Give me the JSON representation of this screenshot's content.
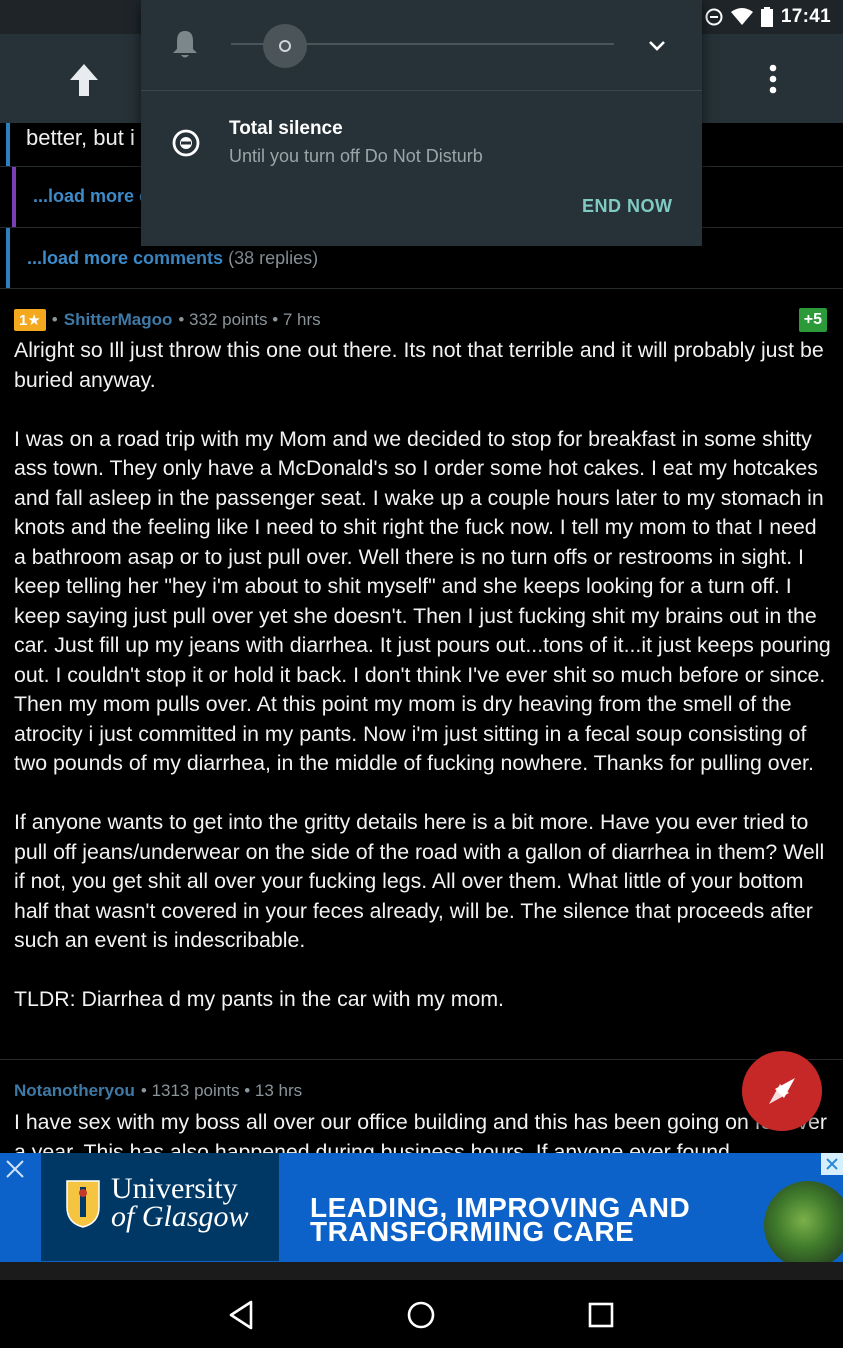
{
  "status_bar": {
    "time": "17:41"
  },
  "app_bar": {},
  "thread": {
    "partial_reply_text": "better, but i",
    "load_more_1": {
      "label": "...load more c"
    },
    "load_more_2": {
      "label": "...load more comments",
      "count": "(38 replies)"
    }
  },
  "comment_1": {
    "rank_badge": "1★",
    "separator": "•",
    "author": "ShitterMagoo",
    "meta": "• 332 points • 7 hrs",
    "score_delta": "+5",
    "paragraphs": [
      "Alright so Ill just throw this one out there. Its not that terrible and it will probably just be buried anyway.",
      "I was on a road trip with my Mom and we decided to stop for breakfast in some shitty ass town. They only have a McDonald's so I order some hot cakes. I eat my hotcakes and fall asleep in the passenger seat. I wake up a couple hours later to my stomach in knots and the feeling like I need to shit right the fuck now. I tell my mom to that I need a bathroom asap or to just pull over. Well there is no turn offs or restrooms in sight. I keep telling her \"hey i'm about to shit myself\" and she keeps looking for a turn off. I keep saying just pull over yet she doesn't. Then I just fucking shit my brains out in the car. Just fill up my jeans with diarrhea. It just pours out...tons of it...it just keeps pouring out. I couldn't stop it or hold it back. I don't think I've ever shit so much before or since. Then my mom pulls over. At this point my mom is dry heaving from the smell of the atrocity i just committed in my pants. Now i'm just sitting in a fecal soup consisting of two pounds of my diarrhea, in the middle of fucking nowhere. Thanks for pulling over.",
      "If anyone wants to get into the gritty details here is a bit more. Have you ever tried to pull off jeans/underwear on the side of the road with a gallon of diarrhea in them? Well if not, you get shit all over your fucking legs. All over them. What little of your bottom half that wasn't covered in your feces already, will be. The silence that proceeds after such an event is indescribable.",
      "TLDR: Diarrhea d my pants in the car with my mom."
    ]
  },
  "comment_2": {
    "author": "Notanotheryou",
    "meta": "• 1313 points • 13 hrs",
    "text": "I have sex with my boss all over our office building and this has been going on for over a year. This has also happened during business hours. If anyone ever found"
  },
  "ad": {
    "logo_line1": "University",
    "logo_line2": "of Glasgow",
    "slogan_line1": "LEADING, IMPROVING AND",
    "slogan_line2": "TRANSFORMING CARE"
  },
  "dnd_panel": {
    "mode_title": "Total silence",
    "mode_subtitle": "Until you turn off Do Not Disturb",
    "end_button": "END NOW"
  },
  "colors": {
    "accent_teal": "#7fcbc4",
    "author_blue": "#3f79a6",
    "load_more_blue": "#3d8bc9",
    "fab_red": "#c62828",
    "score_green": "#2d9a3a",
    "badge_gold": "#f3a81d"
  },
  "icons": [
    "bell-icon",
    "chevron-down-icon",
    "minus-circle-icon",
    "arrow-up-icon",
    "overflow-menu-icon",
    "compass-icon",
    "back-nav-icon",
    "home-nav-icon",
    "recents-nav-icon",
    "close-icon",
    "wifi-icon",
    "battery-icon"
  ]
}
